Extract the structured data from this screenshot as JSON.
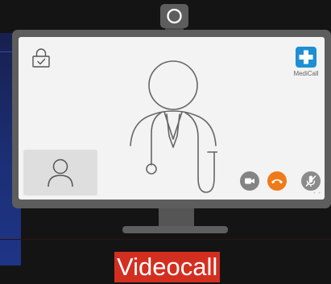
{
  "colors": {
    "background": "#141414",
    "side_panel": "#1e3486",
    "monitor_frame": "#5d5d5d",
    "screen": "#f3f3f3",
    "brand_accent": "#1e8fd3",
    "hangup": "#ef7a1a",
    "control_gray": "#848484",
    "caption_bg": "#d32f20",
    "caption_text": "#ffffff"
  },
  "icons": {
    "webcam": "webcam-icon",
    "lock": "lock-icon",
    "brand": "medical-cross-icon",
    "doctor": "doctor-with-stethoscope-icon",
    "self_view": "user-avatar-icon",
    "video": "video-camera-icon",
    "hangup": "phone-hangup-icon",
    "mute": "microphone-muted-icon"
  },
  "app": {
    "brand_name": "MediCall"
  },
  "caption": {
    "text": "Videocall"
  }
}
